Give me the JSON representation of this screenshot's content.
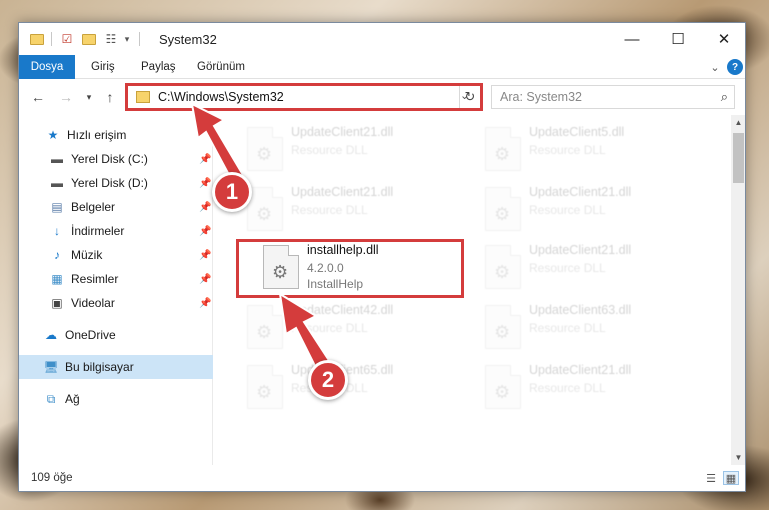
{
  "window": {
    "title": "System32"
  },
  "ribbon": {
    "tabs": [
      "Dosya",
      "Giriş",
      "Paylaş",
      "Görünüm"
    ]
  },
  "address": {
    "path": "C:\\Windows\\System32"
  },
  "search": {
    "placeholder": "Ara: System32"
  },
  "sidebar": {
    "items": [
      {
        "label": "Hızlı erişim",
        "icon": "star-icon"
      },
      {
        "label": "Yerel Disk (C:)",
        "icon": "drive-icon",
        "pinned": true
      },
      {
        "label": "Yerel Disk (D:)",
        "icon": "drive-icon",
        "pinned": true
      },
      {
        "label": "Belgeler",
        "icon": "document-icon",
        "pinned": true
      },
      {
        "label": "İndirmeler",
        "icon": "download-icon",
        "pinned": true
      },
      {
        "label": "Müzik",
        "icon": "music-icon",
        "pinned": true
      },
      {
        "label": "Resimler",
        "icon": "pictures-icon",
        "pinned": true
      },
      {
        "label": "Videolar",
        "icon": "video-icon",
        "pinned": true
      },
      {
        "label": "OneDrive",
        "icon": "cloud-icon"
      },
      {
        "label": "Bu bilgisayar",
        "icon": "computer-icon",
        "selected": true
      },
      {
        "label": "Ağ",
        "icon": "network-icon"
      }
    ]
  },
  "files": [
    {
      "name": "UpdateClient21.dll",
      "line1": "Resource DLL",
      "line2": ""
    },
    {
      "name": "UpdateClient5.dll",
      "line1": "Resource DLL",
      "line2": ""
    },
    {
      "name": "UpdateClient21.dll",
      "line1": "Resource DLL",
      "line2": ""
    },
    {
      "name": "UpdateClient21.dll",
      "line1": "Resource DLL",
      "line2": ""
    },
    {
      "name": "installhelp.dll",
      "line1": "4.2.0.0",
      "line2": "InstallHelp"
    },
    {
      "name": "UpdateClient21.dll",
      "line1": "Resource DLL",
      "line2": ""
    },
    {
      "name": "UpdateClient42.dll",
      "line1": "Resource DLL",
      "line2": ""
    },
    {
      "name": "UpdateClient63.dll",
      "line1": "Resource DLL",
      "line2": ""
    },
    {
      "name": "UpdateClient65.dll",
      "line1": "Resource DLL",
      "line2": ""
    },
    {
      "name": "UpdateClient21.dll",
      "line1": "Resource DLL",
      "line2": ""
    }
  ],
  "status": {
    "count": "109 öğe"
  },
  "annotations": {
    "badge1": "1",
    "badge2": "2"
  },
  "colors": {
    "accent": "#1979ca",
    "highlight": "#d43c3c"
  }
}
